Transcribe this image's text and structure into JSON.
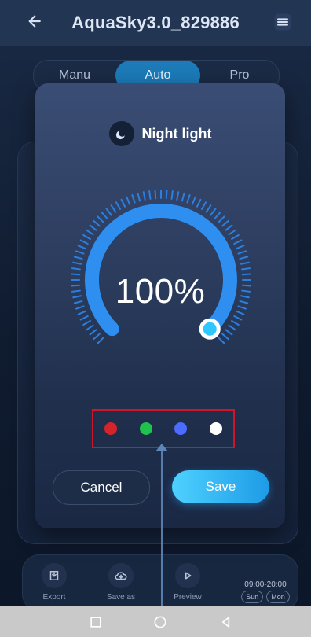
{
  "app": {
    "title": "AquaSky3.0_829886"
  },
  "tabs": {
    "items": [
      "Manu",
      "Auto",
      "Pro"
    ],
    "active": "Auto"
  },
  "modal": {
    "title": "Night light",
    "brightness_percent": 100,
    "brightness_label": "100%",
    "colors": [
      {
        "name": "red",
        "hex": "#d3242b"
      },
      {
        "name": "green",
        "hex": "#1fc24a"
      },
      {
        "name": "blue",
        "hex": "#4b6cff"
      },
      {
        "name": "white",
        "hex": "#ffffff"
      }
    ],
    "buttons": {
      "cancel": "Cancel",
      "save": "Save"
    },
    "accent": "#2f8ff0",
    "knob_color": "#2ec7ff"
  },
  "bottom_actions": {
    "export": "Export",
    "save_as": "Save as",
    "preview": "Preview",
    "schedule_time": "09:00-20:00",
    "days": [
      "Sun",
      "Mon"
    ]
  },
  "system_nav": {
    "icons": [
      "square-icon",
      "circle-icon",
      "triangle-back-icon"
    ]
  }
}
